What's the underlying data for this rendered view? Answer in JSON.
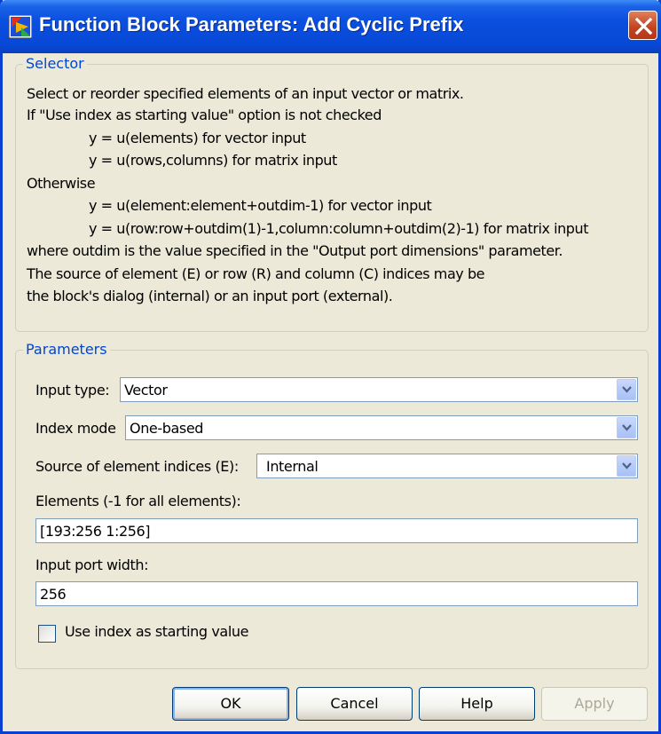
{
  "window": {
    "title": "Function Block Parameters: Add Cyclic Prefix"
  },
  "selector": {
    "legend": "Selector",
    "lines": [
      "Select or reorder specified elements of an input vector or matrix.",
      "If \"Use index as starting value\" option is not checked",
      "y = u(elements) for vector input",
      "y = u(rows,columns) for matrix input",
      "Otherwise",
      "y = u(element:element+outdim-1) for vector input",
      "y = u(row:row+outdim(1)-1,column:column+outdim(2)-1) for matrix input",
      "where outdim is the value specified in the \"Output port dimensions\" parameter.",
      "The source of element (E) or row (R) and column (C) indices may be",
      "the block's dialog (internal) or an input port (external)."
    ]
  },
  "parameters": {
    "legend": "Parameters",
    "input_type": {
      "label": "Input type:",
      "value": "Vector"
    },
    "index_mode": {
      "label": "Index mode",
      "value": "One-based"
    },
    "source_indices": {
      "label": "Source of element indices (E):",
      "value": "Internal"
    },
    "elements": {
      "label": "Elements (-1 for all elements):",
      "value": "[193:256 1:256]"
    },
    "input_port_width": {
      "label": "Input port width:",
      "value": "256"
    },
    "use_index": {
      "label": "Use index as starting value",
      "checked": false
    }
  },
  "buttons": {
    "ok": "OK",
    "cancel": "Cancel",
    "help": "Help",
    "apply": "Apply"
  },
  "colors": {
    "titlebar": "#0a4fdf",
    "legend_text": "#0046d5",
    "window_bg": "#ece9d8"
  }
}
